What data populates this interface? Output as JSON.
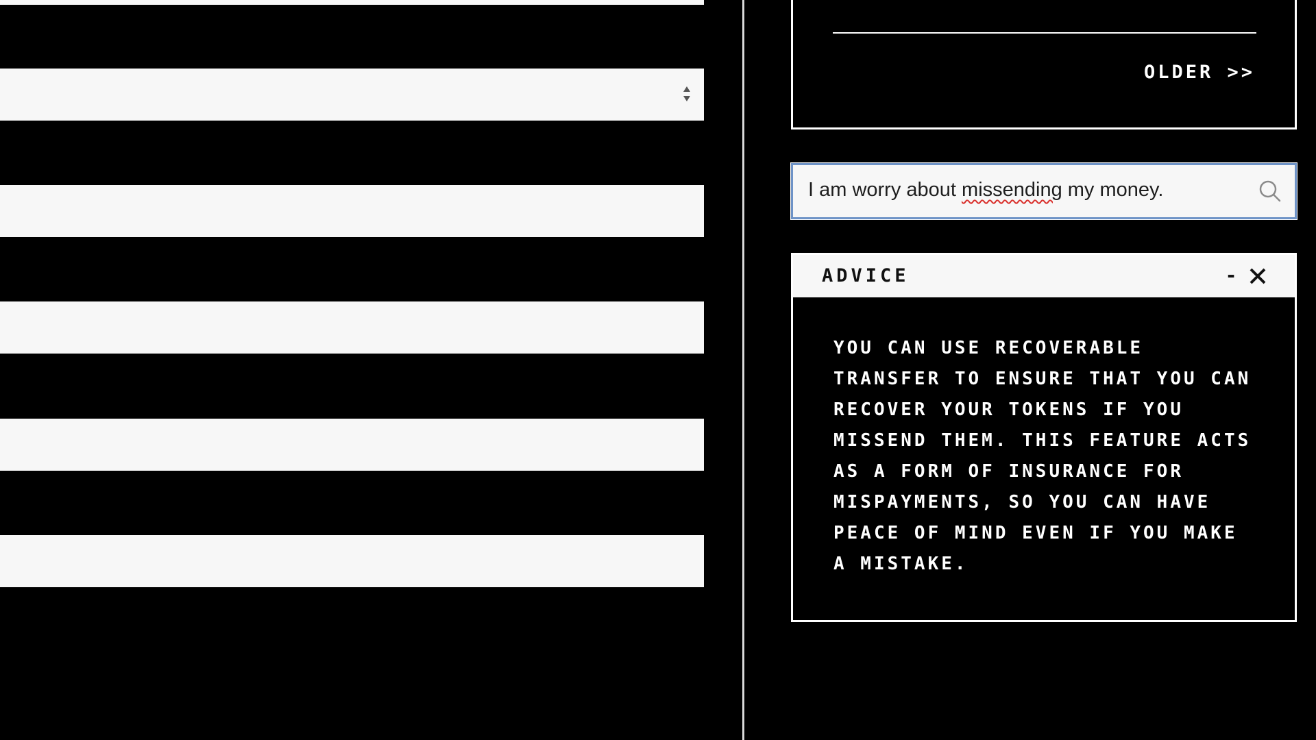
{
  "form": {
    "select_arrows_icon": "select-updown-arrows-icon"
  },
  "history": {
    "older_label": "OLDER >>"
  },
  "search": {
    "value_before": "I am worry about ",
    "value_misspelled": "missending",
    "value_after": " my money.",
    "icon": "search-icon"
  },
  "advice": {
    "title": "ADVICE",
    "minimize_label": "-",
    "close_icon": "close-icon",
    "body": "YOU CAN USE RECOVERABLE TRANSFER TO ENSURE THAT YOU CAN RECOVER YOUR TOKENS IF YOU MISSEND THEM. THIS FEATURE ACTS AS A FORM OF INSURANCE FOR MISPAYMENTS, SO YOU CAN HAVE PEACE OF MIND EVEN IF YOU MAKE A MISTAKE."
  },
  "colors": {
    "background": "#000000",
    "field": "#f7f7f7",
    "focus_border": "#6e93c7",
    "spellcheck": "#d9302c"
  }
}
